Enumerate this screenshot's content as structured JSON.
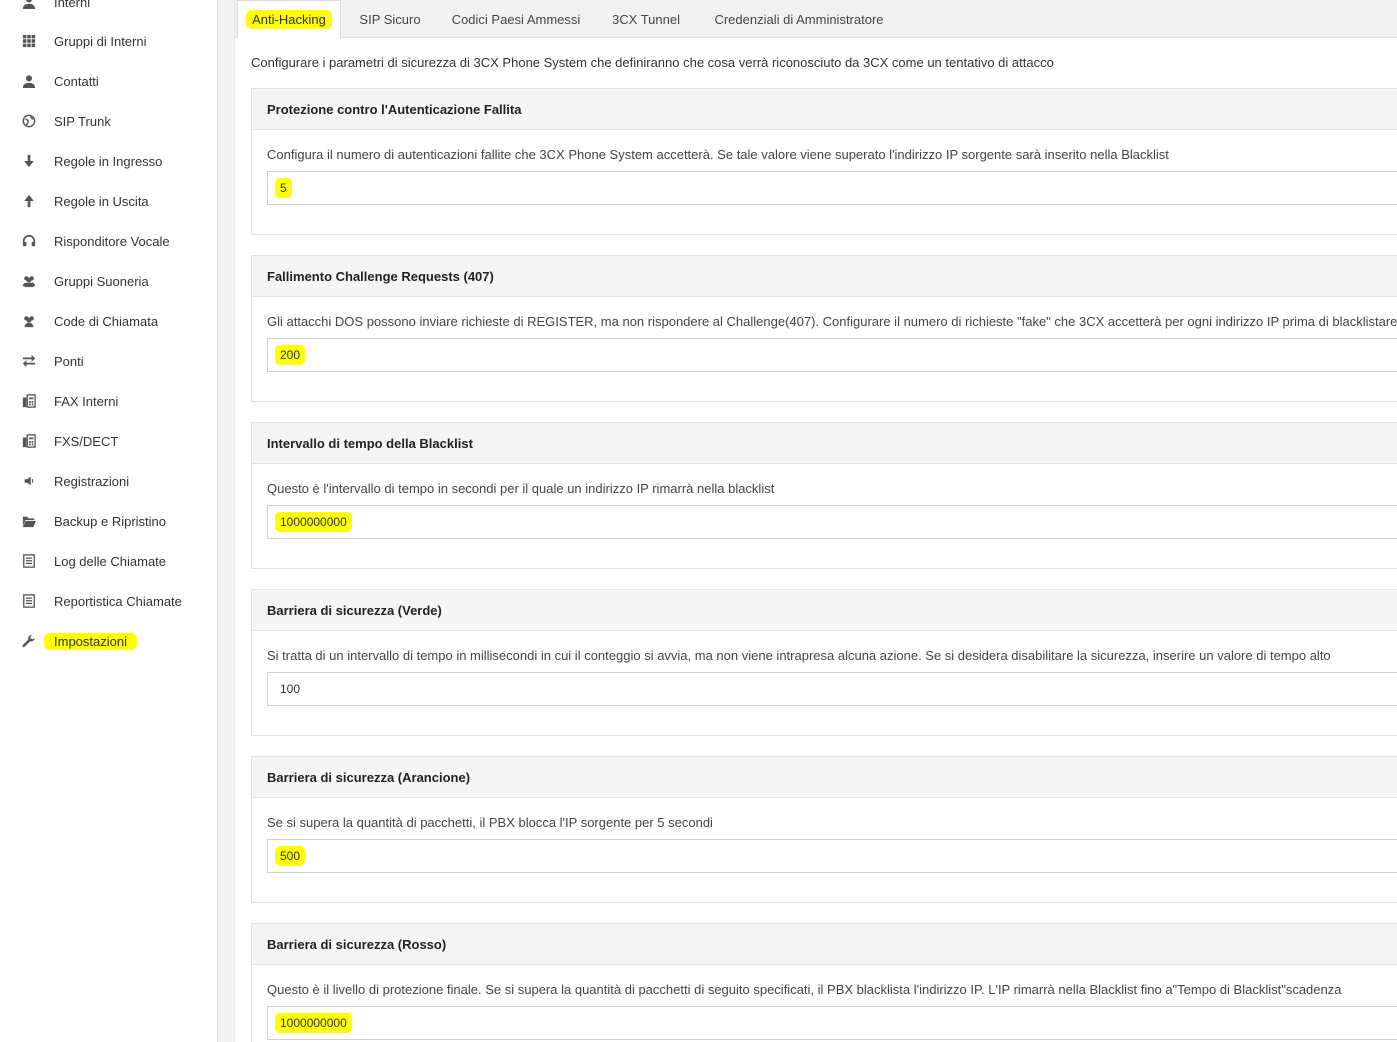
{
  "sidebar": {
    "items": [
      {
        "label": "Interni",
        "icon": "user-icon"
      },
      {
        "label": "Gruppi di Interni",
        "icon": "grid-icon"
      },
      {
        "label": "Contatti",
        "icon": "user-icon"
      },
      {
        "label": "SIP Trunk",
        "icon": "globe-icon"
      },
      {
        "label": "Regole in Ingresso",
        "icon": "arrow-down-icon"
      },
      {
        "label": "Regole in Uscita",
        "icon": "arrow-up-icon"
      },
      {
        "label": "Risponditore Vocale",
        "icon": "headset-icon"
      },
      {
        "label": "Gruppi Suoneria",
        "icon": "users-icon"
      },
      {
        "label": "Code di Chiamata",
        "icon": "users-icon"
      },
      {
        "label": "Ponti",
        "icon": "exchange-icon"
      },
      {
        "label": "FAX Interni",
        "icon": "fax-icon"
      },
      {
        "label": "FXS/DECT",
        "icon": "fax-icon"
      },
      {
        "label": "Registrazioni",
        "icon": "speaker-icon"
      },
      {
        "label": "Backup e Ripristino",
        "icon": "folder-icon"
      },
      {
        "label": "Log delle Chiamate",
        "icon": "list-icon"
      },
      {
        "label": "Reportistica Chiamate",
        "icon": "list-icon"
      },
      {
        "label": "Impostazioni",
        "icon": "wrench-icon"
      }
    ]
  },
  "tabs": [
    {
      "label": "Anti-Hacking"
    },
    {
      "label": "SIP Sicuro"
    },
    {
      "label": "Codici Paesi Ammessi"
    },
    {
      "label": "3CX Tunnel"
    },
    {
      "label": "Credenziali di Amministratore"
    }
  ],
  "intro": "Configurare i parametri di sicurezza di 3CX Phone System che definiranno che cosa verrà riconosciuto da 3CX come un tentativo di attacco",
  "panels": [
    {
      "title": "Protezione contro l'Autenticazione Fallita",
      "desc": "Configura il numero di autenticazioni fallite che 3CX Phone System accetterà. Se tale valore viene superato l'indirizzo IP sorgente sarà inserito nella Blacklist",
      "value": "5"
    },
    {
      "title": "Fallimento Challenge Requests (407)",
      "desc": "Gli attacchi DOS possono inviare richieste di REGISTER, ma non rispondere al Challenge(407). Configurare il numero di richieste \"fake\" che 3CX accetterà per ogni indirizzo IP prima di blacklistare l'",
      "value": "200"
    },
    {
      "title": "Intervallo di tempo della Blacklist",
      "desc": "Questo è l'intervallo di tempo in secondi per il quale un indirizzo IP rimarrà nella blacklist",
      "value": "1000000000"
    },
    {
      "title": "Barriera di sicurezza (Verde)",
      "desc": "Si tratta di un intervallo di tempo in millisecondi in cui il conteggio si avvia, ma non viene intrapresa alcuna azione. Se si desidera disabilitare la sicurezza, inserire un valore di tempo alto",
      "value": "100"
    },
    {
      "title": "Barriera di sicurezza (Arancione)",
      "desc": "Se si supera la quantità di pacchetti, il PBX blocca l'IP sorgente per 5 secondi",
      "value": "500"
    },
    {
      "title": "Barriera di sicurezza (Rosso)",
      "desc": "Questo è il livello di protezione finale. Se si supera la quantità di pacchetti di seguito specificati, il PBX blacklista l'indirizzo IP. L'IP rimarrà nella Blacklist fino a\"Tempo di Blacklist\"scadenza",
      "value": "1000000000"
    }
  ],
  "colors": {
    "highlight": "#ffff00",
    "panel_header_bg": "#f5f5f5"
  }
}
